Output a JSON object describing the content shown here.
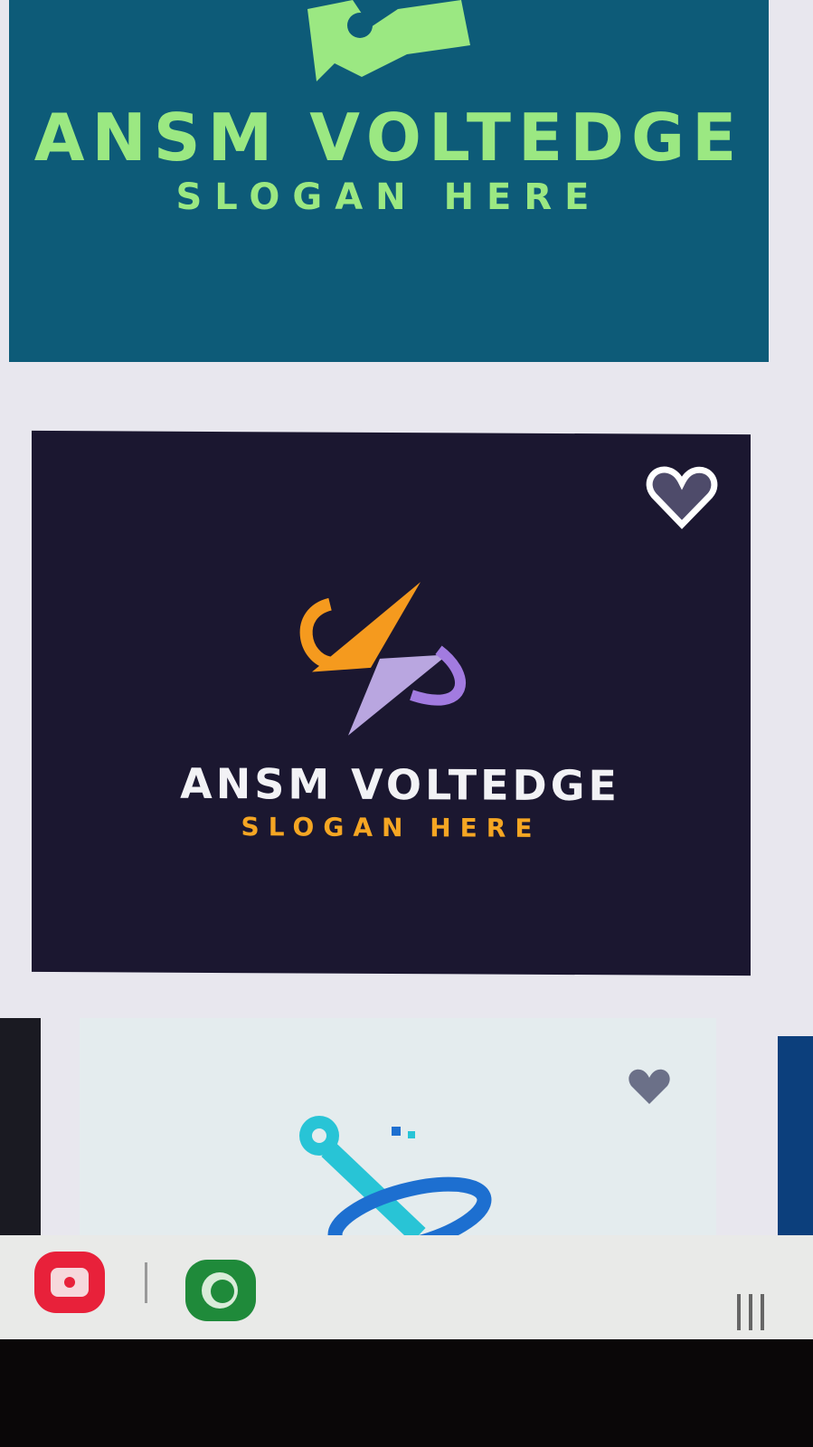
{
  "cards": [
    {
      "name": "ANSM VOLTEDGE",
      "slogan": "SLOGAN HERE",
      "bg": "#0d5b78",
      "text_color": "#9be882"
    },
    {
      "name": "ANSM VOLTEDGE",
      "slogan": "SLOGAN HERE",
      "bg": "#1b1730",
      "text_color": "#f2f2f5",
      "slogan_color": "#f5a623",
      "favorite_icon": "heart-outline-icon"
    },
    {
      "bg": "#e4ecee",
      "favorite_icon": "heart-icon"
    }
  ],
  "taskbar": {
    "apps": [
      {
        "icon": "camera-app-icon",
        "color": "#e8213a"
      },
      {
        "icon": "chat-app-icon",
        "color": "#1f8a3a"
      }
    ],
    "recents_icon": "recent-apps-icon"
  }
}
